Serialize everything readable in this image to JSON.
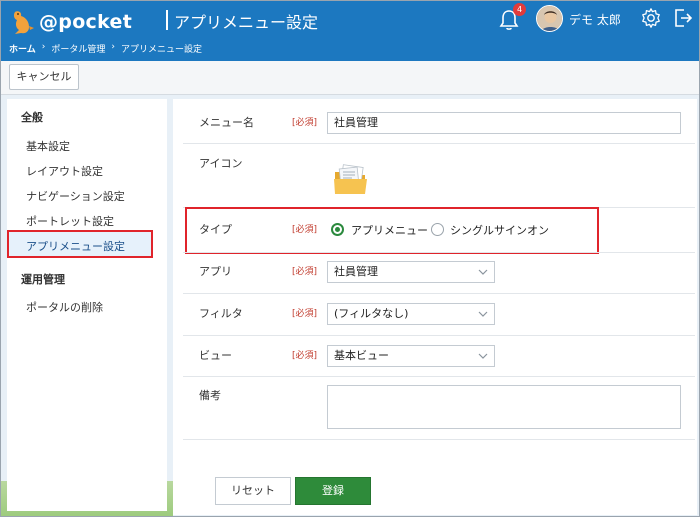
{
  "header": {
    "logo_text": "@pocket",
    "title": "アプリメニュー設定",
    "notification_count": "4",
    "user_name": "デモ 太郎",
    "brand_color": "#1c78c0"
  },
  "breadcrumb": {
    "items": [
      "ホーム",
      "ポータル管理",
      "アプリメニュー設定"
    ],
    "separator": "›"
  },
  "toolbar": {
    "cancel_label": "キャンセル"
  },
  "sidebar": {
    "section_general": "全般",
    "items": [
      "基本設定",
      "レイアウト設定",
      "ナビゲーション設定",
      "ポートレット設定",
      "アプリメニュー設定"
    ],
    "section_admin": "運用管理",
    "admin_items": [
      "ポータルの削除"
    ]
  },
  "form": {
    "required_mark": "[必須]",
    "menu_name": {
      "label": "メニュー名",
      "value": "社員管理"
    },
    "icon": {
      "label": "アイコン",
      "icon_name": "folder-icon"
    },
    "type": {
      "label": "タイプ",
      "options": [
        "アプリメニュー",
        "シングルサインオン"
      ],
      "selected": "アプリメニュー"
    },
    "app": {
      "label": "アプリ",
      "value": "社員管理"
    },
    "filter": {
      "label": "フィルタ",
      "value": "(フィルタなし)"
    },
    "view": {
      "label": "ビュー",
      "value": "基本ビュー"
    },
    "note": {
      "label": "備考",
      "value": ""
    }
  },
  "actions": {
    "reset_label": "リセット",
    "submit_label": "登録"
  },
  "colors": {
    "highlight": "#e0242b",
    "submit": "#2e8b3a"
  }
}
